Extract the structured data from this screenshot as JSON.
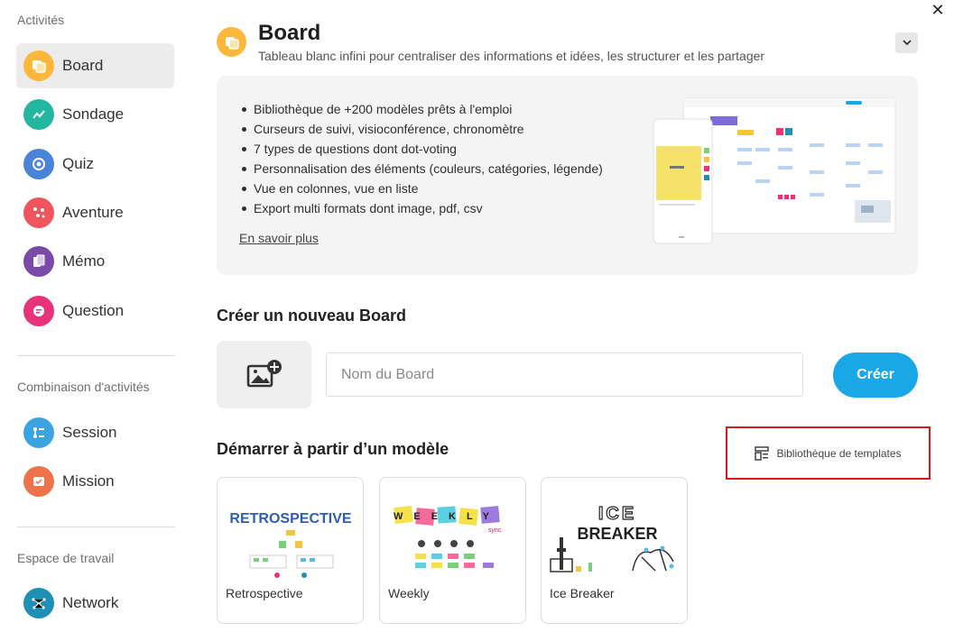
{
  "sidebar": {
    "sections": [
      {
        "title": "Activités"
      },
      {
        "title": "Combinaison d'activités"
      },
      {
        "title": "Espace de travail"
      }
    ],
    "items": [
      {
        "label": "Board",
        "icon": "board-icon",
        "color": "#fdb73b"
      },
      {
        "label": "Sondage",
        "icon": "poll-icon",
        "color": "#23b7a0"
      },
      {
        "label": "Quiz",
        "icon": "quiz-icon",
        "color": "#4a84d8"
      },
      {
        "label": "Aventure",
        "icon": "adventure-icon",
        "color": "#f0545c"
      },
      {
        "label": "Mémo",
        "icon": "memo-icon",
        "color": "#7a4aa8"
      },
      {
        "label": "Question",
        "icon": "question-icon",
        "color": "#e8327a"
      },
      {
        "label": "Session",
        "icon": "session-icon",
        "color": "#3ba3e0"
      },
      {
        "label": "Mission",
        "icon": "mission-icon",
        "color": "#f0724a"
      },
      {
        "label": "Network",
        "icon": "network-icon",
        "color": "#1e8fb5"
      }
    ]
  },
  "header": {
    "title": "Board",
    "description": "Tableau blanc infini pour centraliser des informations et idées, les structurer et les partager"
  },
  "features": {
    "items": [
      "Bibliothèque de +200 modèles prêts à l'emploi",
      "Curseurs de suivi, visioconférence, chronomètre",
      "7 types de questions dont dot-voting",
      "Personnalisation des éléments (couleurs, catégories, légende)",
      "Vue en colonnes, vue en liste",
      "Export multi formats dont image, pdf, csv"
    ],
    "learn_more": "En savoir plus"
  },
  "create": {
    "title": "Créer un nouveau Board",
    "input_placeholder": "Nom du Board",
    "button": "Créer"
  },
  "templates": {
    "title": "Démarrer à partir d’un modèle",
    "library_label": "Bibliothèque de templates",
    "cards": [
      {
        "name": "Retrospective",
        "thumb_text": "RETROSPECTIVE"
      },
      {
        "name": "Weekly",
        "thumb_text": "WEEKLY",
        "thumb_sub": "sync."
      },
      {
        "name": "Ice Breaker",
        "thumb_text": "ICE",
        "thumb_sub": "BREAKER"
      }
    ]
  },
  "colors": {
    "accent": "#1aa7e8",
    "highlight_border": "#d11a1a"
  }
}
